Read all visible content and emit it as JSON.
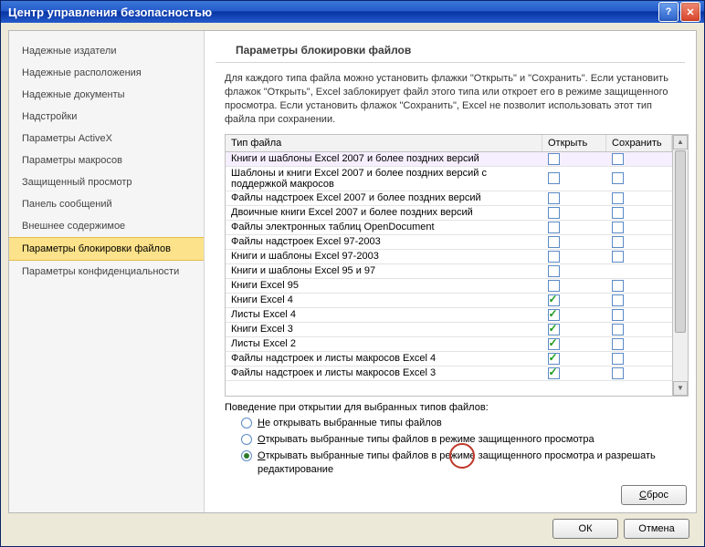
{
  "window": {
    "title": "Центр управления безопасностью"
  },
  "sidebar": {
    "items": [
      {
        "label": "Надежные издатели"
      },
      {
        "label": "Надежные расположения"
      },
      {
        "label": "Надежные документы"
      },
      {
        "label": "Надстройки"
      },
      {
        "label": "Параметры ActiveX"
      },
      {
        "label": "Параметры макросов"
      },
      {
        "label": "Защищенный просмотр"
      },
      {
        "label": "Панель сообщений"
      },
      {
        "label": "Внешнее содержимое"
      },
      {
        "label": "Параметры блокировки файлов"
      },
      {
        "label": "Параметры конфиденциальности"
      }
    ],
    "active_index": 9
  },
  "main": {
    "heading": "Параметры блокировки файлов",
    "description": "Для каждого типа файла можно установить флажки \"Открыть\" и \"Сохранить\". Если установить флажок \"Открыть\", Excel заблокирует файл этого типа или откроет его в режиме защищенного просмотра. Если установить флажок \"Сохранить\", Excel не позволит использовать этот тип файла при сохранении.",
    "columns": {
      "type": "Тип файла",
      "open": "Открыть",
      "save": "Сохранить"
    },
    "rows": [
      {
        "type": "Книги и шаблоны Excel 2007 и более поздних версий",
        "open": false,
        "save": false
      },
      {
        "type": "Шаблоны и книги Excel 2007 и более поздних версий с поддержкой макросов",
        "open": false,
        "save": false
      },
      {
        "type": "Файлы надстроек Excel 2007 и более поздних версий",
        "open": false,
        "save": false
      },
      {
        "type": "Двоичные книги Excel 2007 и более поздних версий",
        "open": false,
        "save": false
      },
      {
        "type": "Файлы электронных таблиц OpenDocument",
        "open": false,
        "save": false
      },
      {
        "type": "Файлы надстроек Excel 97-2003",
        "open": false,
        "save": false
      },
      {
        "type": "Книги и шаблоны Excel 97-2003",
        "open": false,
        "save": false
      },
      {
        "type": "Книги и шаблоны Excel 95 и 97",
        "open": false,
        "save": null
      },
      {
        "type": "Книги Excel 95",
        "open": false,
        "save": false
      },
      {
        "type": "Книги Excel 4",
        "open": true,
        "save": false
      },
      {
        "type": "Листы Excel 4",
        "open": true,
        "save": false
      },
      {
        "type": "Книги Excel 3",
        "open": true,
        "save": false
      },
      {
        "type": "Листы Excel 2",
        "open": true,
        "save": false
      },
      {
        "type": "Файлы надстроек и листы макросов Excel 4",
        "open": true,
        "save": false
      },
      {
        "type": "Файлы надстроек и листы макросов Excel 3",
        "open": true,
        "save": false
      }
    ],
    "behavior": {
      "label": "Поведение при открытии для выбранных типов файлов:",
      "options": [
        {
          "label": "Не открывать выбранные типы файлов",
          "checked": false
        },
        {
          "label": "Открывать выбранные типы файлов в режиме защищенного просмотра",
          "checked": false
        },
        {
          "label": "Открывать выбранные типы файлов в режиме защищенного просмотра и разрешать редактирование",
          "checked": true
        }
      ]
    },
    "reset": "Сброс"
  },
  "footer": {
    "ok": "ОК",
    "cancel": "Отмена"
  }
}
